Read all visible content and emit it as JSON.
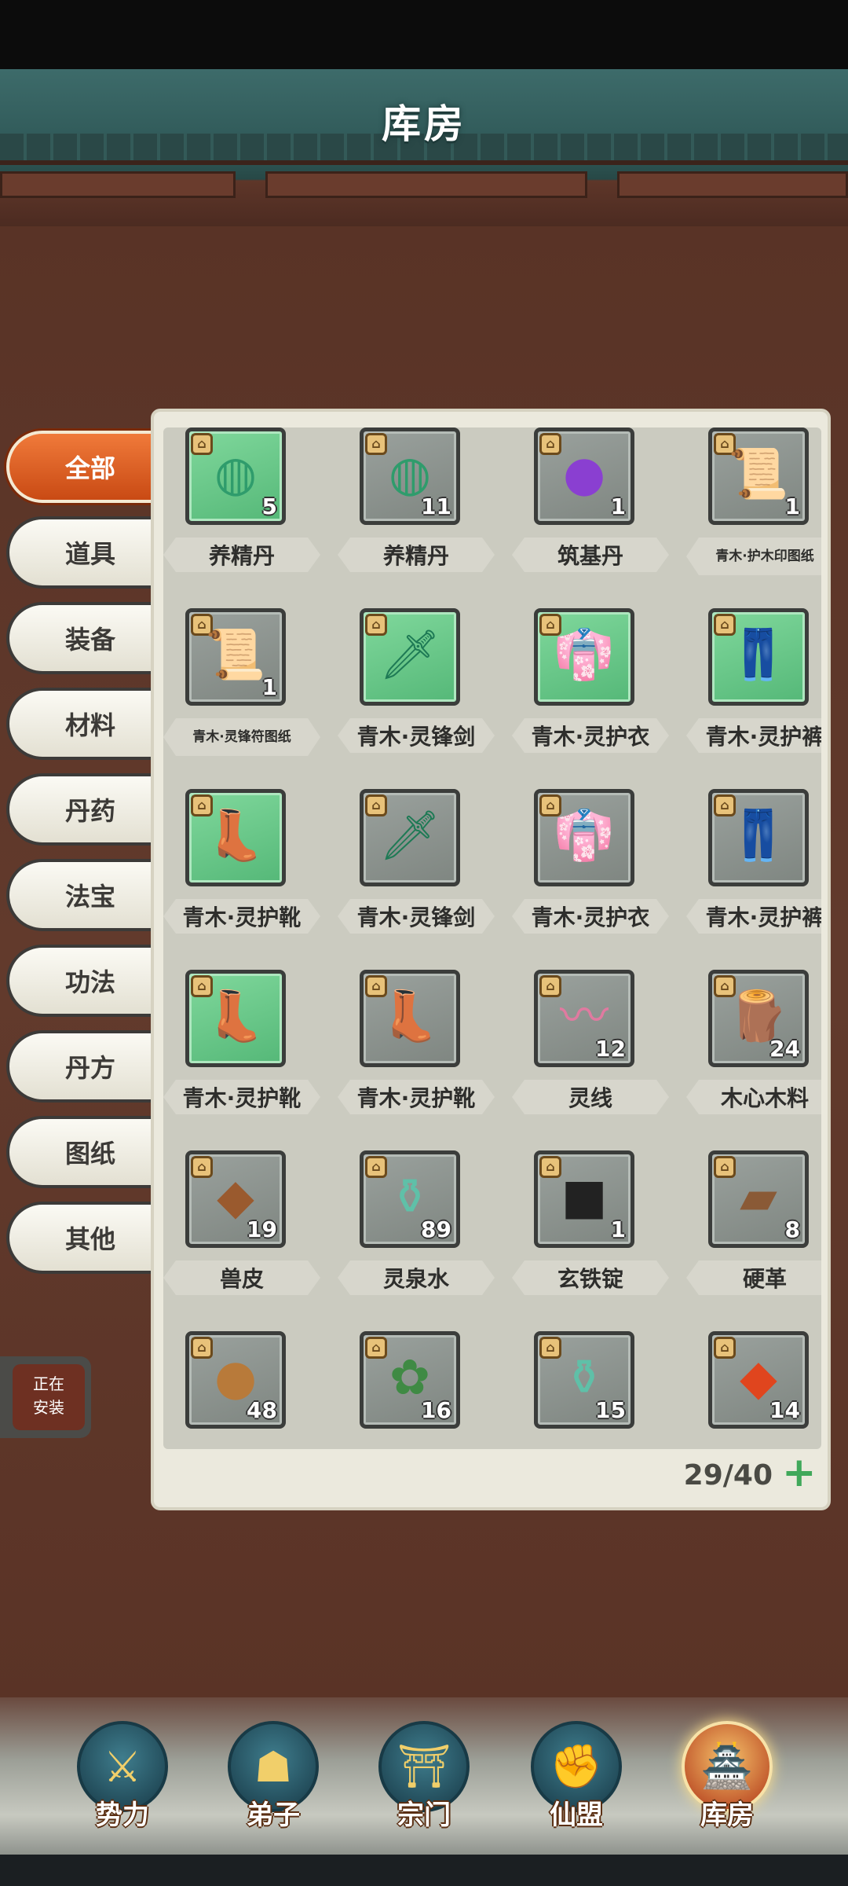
{
  "header": {
    "title": "库房"
  },
  "tabs": [
    {
      "label": "全部",
      "active": true
    },
    {
      "label": "道具",
      "active": false
    },
    {
      "label": "装备",
      "active": false
    },
    {
      "label": "材料",
      "active": false
    },
    {
      "label": "丹药",
      "active": false
    },
    {
      "label": "法宝",
      "active": false
    },
    {
      "label": "功法",
      "active": false
    },
    {
      "label": "丹方",
      "active": false
    },
    {
      "label": "图纸",
      "active": false
    },
    {
      "label": "其他",
      "active": false
    }
  ],
  "items": [
    {
      "name": "养精丹",
      "count": "5",
      "green": true,
      "icon": "◍",
      "icon_color": "#2f9c6c",
      "small": false
    },
    {
      "name": "养精丹",
      "count": "11",
      "green": false,
      "icon": "◍",
      "icon_color": "#2f9c6c",
      "small": false
    },
    {
      "name": "筑基丹",
      "count": "1",
      "green": false,
      "icon": "●",
      "icon_color": "#8a3fd1",
      "small": false
    },
    {
      "name": "青木·护木印图纸",
      "count": "1",
      "green": false,
      "icon": "📜",
      "icon_color": "#c99b3a",
      "small": true
    },
    {
      "name": "青木·灵锋符图纸",
      "count": "1",
      "green": false,
      "icon": "📜",
      "icon_color": "#c99b3a",
      "small": true
    },
    {
      "name": "青木·灵锋剑",
      "count": "",
      "green": true,
      "icon": "🗡",
      "icon_color": "#1e7a55",
      "small": false
    },
    {
      "name": "青木·灵护衣",
      "count": "",
      "green": true,
      "icon": "👘",
      "icon_color": "#1e7a55",
      "small": false
    },
    {
      "name": "青木·灵护裤",
      "count": "",
      "green": true,
      "icon": "👖",
      "icon_color": "#1e7a55",
      "small": false
    },
    {
      "name": "青木·灵护靴",
      "count": "",
      "green": true,
      "icon": "👢",
      "icon_color": "#1e5a55",
      "small": false
    },
    {
      "name": "青木·灵锋剑",
      "count": "",
      "green": false,
      "icon": "🗡",
      "icon_color": "#1e7a55",
      "small": false
    },
    {
      "name": "青木·灵护衣",
      "count": "",
      "green": false,
      "icon": "👘",
      "icon_color": "#1e7a55",
      "small": false
    },
    {
      "name": "青木·灵护裤",
      "count": "",
      "green": false,
      "icon": "👖",
      "icon_color": "#1e7a55",
      "small": false
    },
    {
      "name": "青木·灵护靴",
      "count": "",
      "green": true,
      "icon": "👢",
      "icon_color": "#1e5a55",
      "small": false
    },
    {
      "name": "青木·灵护靴",
      "count": "",
      "green": false,
      "icon": "👢",
      "icon_color": "#1e5a55",
      "small": false
    },
    {
      "name": "灵线",
      "count": "12",
      "green": false,
      "icon": "〰",
      "icon_color": "#e07aa0",
      "small": false
    },
    {
      "name": "木心木料",
      "count": "24",
      "green": false,
      "icon": "🪵",
      "icon_color": "#7a4a2a",
      "small": false
    },
    {
      "name": "兽皮",
      "count": "19",
      "green": false,
      "icon": "◆",
      "icon_color": "#9a5a2e",
      "small": false
    },
    {
      "name": "灵泉水",
      "count": "89",
      "green": false,
      "icon": "⚱",
      "icon_color": "#5fc0a8",
      "small": false
    },
    {
      "name": "玄铁锭",
      "count": "1",
      "green": false,
      "icon": "■",
      "icon_color": "#222222",
      "small": false
    },
    {
      "name": "硬革",
      "count": "8",
      "green": false,
      "icon": "▰",
      "icon_color": "#8a5a36",
      "small": false
    },
    {
      "name": "",
      "count": "48",
      "green": false,
      "icon": "●",
      "icon_color": "#b87a3a",
      "small": false
    },
    {
      "name": "",
      "count": "16",
      "green": false,
      "icon": "✿",
      "icon_color": "#3f8a44",
      "small": false
    },
    {
      "name": "",
      "count": "15",
      "green": false,
      "icon": "⚱",
      "icon_color": "#5fc0a8",
      "small": false
    },
    {
      "name": "",
      "count": "14",
      "green": false,
      "icon": "◆",
      "icon_color": "#e0451e",
      "small": false
    }
  ],
  "capacity": "29/40",
  "installing": {
    "line1": "正在",
    "line2": "安装"
  },
  "nav": [
    {
      "label": "势力",
      "icon": "⚔",
      "active": false
    },
    {
      "label": "弟子",
      "icon": "☗",
      "active": false
    },
    {
      "label": "宗门",
      "icon": "⛩",
      "active": false
    },
    {
      "label": "仙盟",
      "icon": "✊",
      "active": false
    },
    {
      "label": "库房",
      "icon": "🏯",
      "active": true
    }
  ]
}
